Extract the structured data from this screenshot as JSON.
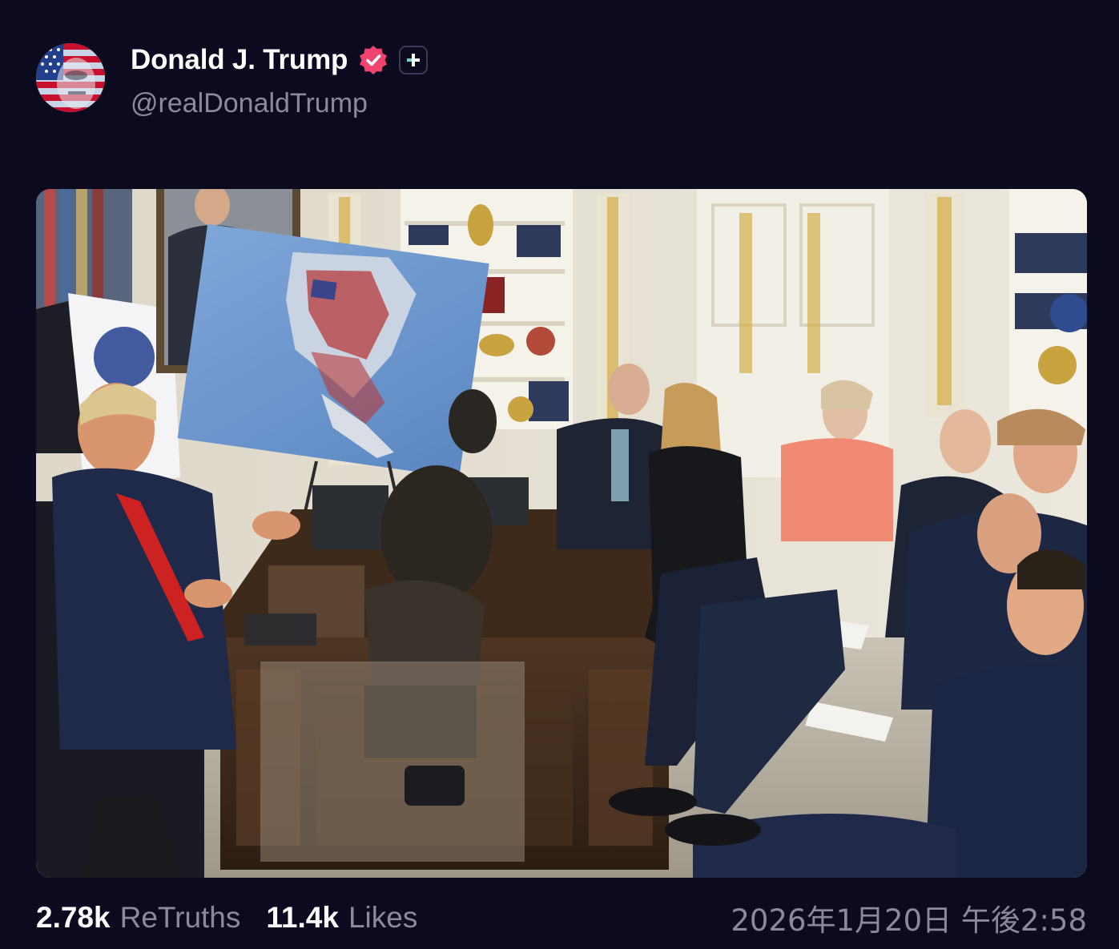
{
  "author": {
    "display_name": "Donald J. Trump",
    "handle": "@realDonaldTrump",
    "avatar_icon": "avatar-flag-portrait",
    "verified_icon": "verified-badge-icon",
    "verified_color": "#f0436e",
    "plus_icon": "plus-icon"
  },
  "media": {
    "alt": "photo"
  },
  "stats": {
    "retruths_count": "2.78k",
    "retruths_label": "ReTruths",
    "likes_count": "11.4k",
    "likes_label": "Likes"
  },
  "timestamp": "2026年1月20日 午後2:58",
  "colors": {
    "background": "#0b0a1e",
    "primary_text": "#ffffff",
    "secondary_text": "#8b8a9c"
  }
}
